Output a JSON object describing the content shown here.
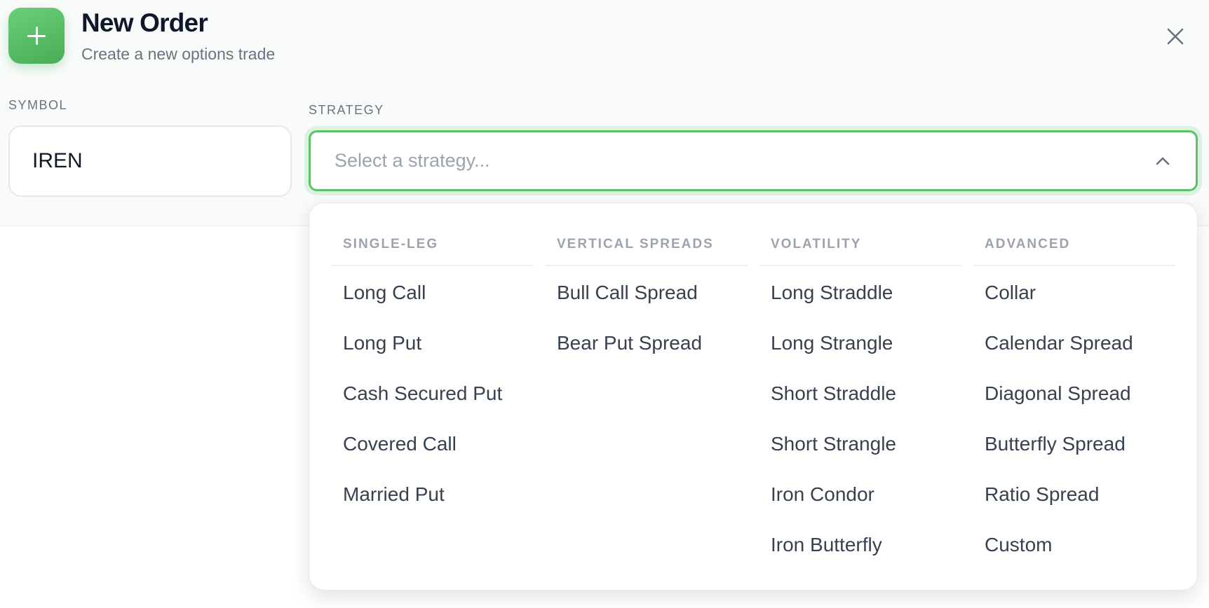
{
  "header": {
    "title": "New Order",
    "subtitle": "Create a new options trade",
    "icon": "plus-icon",
    "close_icon": "close-icon"
  },
  "symbol": {
    "label": "SYMBOL",
    "value": "IREN"
  },
  "strategy": {
    "label": "STRATEGY",
    "placeholder": "Select a strategy...",
    "chevron_icon": "chevron-up-icon"
  },
  "dropdown": {
    "columns": [
      {
        "heading": "SINGLE-LEG",
        "items": [
          "Long Call",
          "Long Put",
          "Cash Secured Put",
          "Covered Call",
          "Married Put"
        ]
      },
      {
        "heading": "VERTICAL SPREADS",
        "items": [
          "Bull Call Spread",
          "Bear Put Spread"
        ]
      },
      {
        "heading": "VOLATILITY",
        "items": [
          "Long Straddle",
          "Long Strangle",
          "Short Straddle",
          "Short Strangle",
          "Iron Condor",
          "Iron Butterfly"
        ]
      },
      {
        "heading": "ADVANCED",
        "items": [
          "Collar",
          "Calendar Spread",
          "Diagonal Spread",
          "Butterfly Spread",
          "Ratio Spread",
          "Custom"
        ]
      }
    ]
  },
  "colors": {
    "accent": "#5cc267",
    "accent_glow": "#dcf2de",
    "icon_gradient_start": "#6ccf78",
    "icon_gradient_end": "#48ad56",
    "muted_text": "#9ca3af"
  }
}
